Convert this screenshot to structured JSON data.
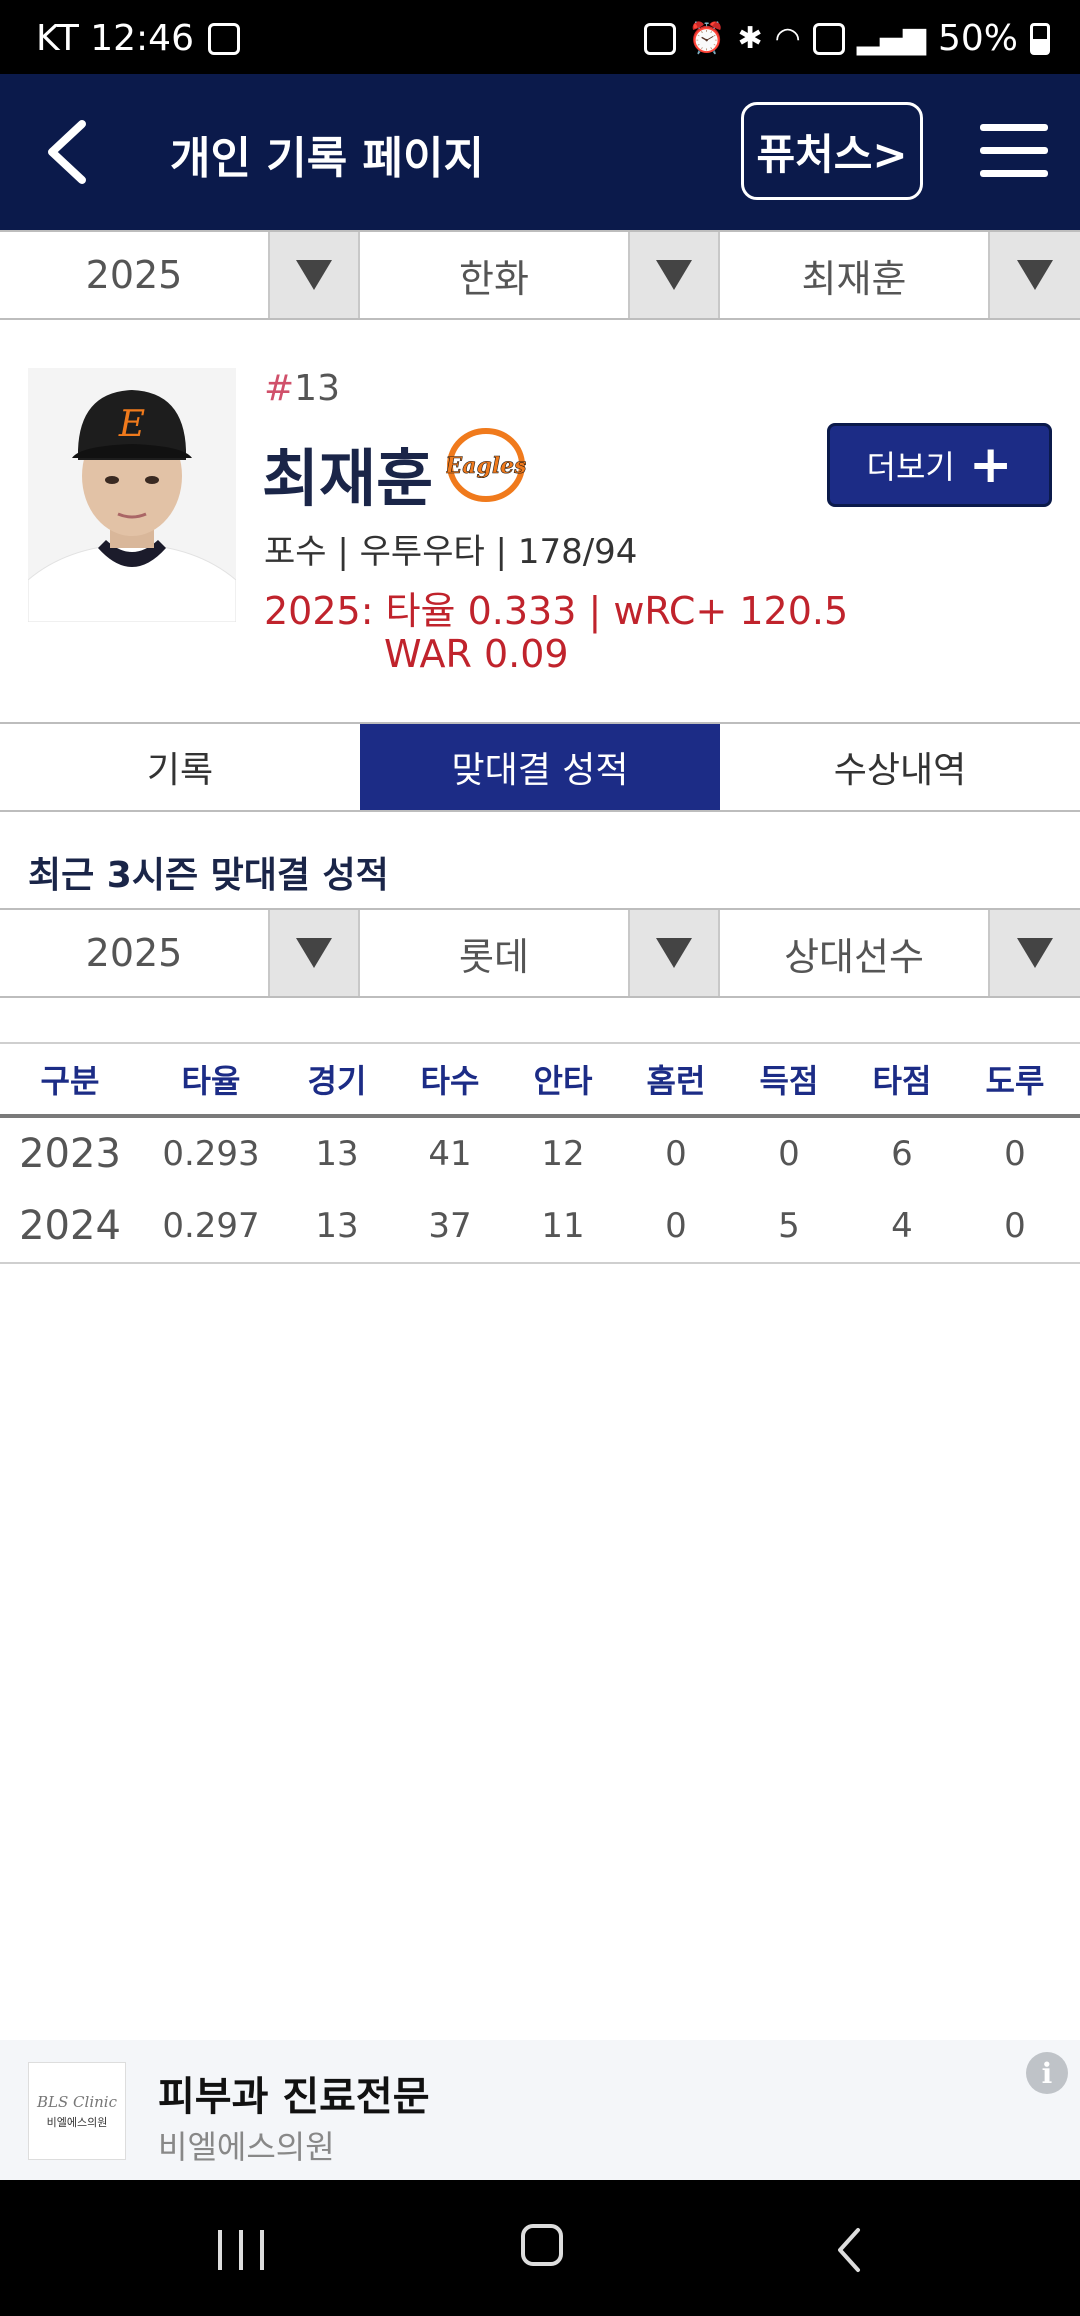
{
  "status_bar": {
    "carrier_time": "KT 12:46",
    "battery": "50%"
  },
  "app_bar": {
    "title": "개인 기록 페이지",
    "futures_label": "퓨처스>"
  },
  "filters": {
    "year": "2025",
    "team": "한화",
    "player": "최재훈"
  },
  "player": {
    "hash": "#",
    "number": "13",
    "name": "최재훈",
    "team_logo_text": "Eagles",
    "info": "포수 | 우투우타 | 178/94",
    "stat_line1": "2025: 타율 0.333 | wRC+ 120.5",
    "stat_line2": "WAR 0.09",
    "more_label": "더보기",
    "more_icon": "plus-icon"
  },
  "tabs": [
    {
      "label": "기록",
      "active": false
    },
    {
      "label": "맞대결 성적",
      "active": true
    },
    {
      "label": "수상내역",
      "active": false
    }
  ],
  "section": {
    "title": "최근 3시즌 맞대결 성적"
  },
  "matchup_filters": {
    "year": "2025",
    "team": "롯데",
    "opponent": "상대선수"
  },
  "table": {
    "headers": [
      "구분",
      "타율",
      "경기",
      "타수",
      "안타",
      "홈런",
      "득점",
      "타점",
      "도루"
    ],
    "rows": [
      [
        "2023",
        "0.293",
        "13",
        "41",
        "12",
        "0",
        "0",
        "6",
        "0"
      ],
      [
        "2024",
        "0.297",
        "13",
        "37",
        "11",
        "0",
        "5",
        "4",
        "0"
      ]
    ]
  },
  "ad": {
    "logo_line1": "BLS Clinic",
    "logo_line2": "비엘에스의원",
    "title": "피부과 진료전문",
    "subtitle": "비엘에스의원"
  },
  "colors": {
    "navy": "#0b1a4b",
    "accent": "#1c2c86",
    "stat_red": "#c0232c",
    "number_pink": "#d0506a"
  }
}
